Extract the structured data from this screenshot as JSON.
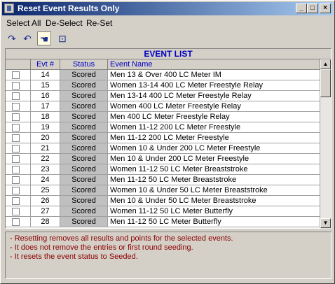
{
  "window": {
    "title": "Reset Event Results Only"
  },
  "title_buttons": {
    "minimize": "_",
    "maximize": "□",
    "close": "×"
  },
  "menu": [
    "Select All",
    "De-Select",
    "Re-Set"
  ],
  "toolbar": {
    "icons": [
      "redo-icon",
      "undo-icon",
      "select-all-icon",
      "open-folder-icon"
    ]
  },
  "grid": {
    "title": "EVENT LIST",
    "headers": {
      "check": "",
      "evt": "Evt #",
      "status": "Status",
      "name": "Event Name"
    },
    "rows": [
      {
        "evt": "14",
        "status": "Scored",
        "name": "Men 13 & Over 400 LC Meter IM"
      },
      {
        "evt": "15",
        "status": "Scored",
        "name": "Women 13-14 400 LC Meter Freestyle Relay"
      },
      {
        "evt": "16",
        "status": "Scored",
        "name": "Men 13-14 400 LC Meter Freestyle Relay"
      },
      {
        "evt": "17",
        "status": "Scored",
        "name": "Women 400 LC Meter Freestyle Relay"
      },
      {
        "evt": "18",
        "status": "Scored",
        "name": "Men 400 LC Meter Freestyle Relay"
      },
      {
        "evt": "19",
        "status": "Scored",
        "name": "Women 11-12 200 LC Meter Freestyle"
      },
      {
        "evt": "20",
        "status": "Scored",
        "name": "Men 11-12 200 LC Meter Freestyle"
      },
      {
        "evt": "21",
        "status": "Scored",
        "name": "Women 10 & Under 200 LC Meter Freestyle"
      },
      {
        "evt": "22",
        "status": "Scored",
        "name": "Men 10 & Under 200 LC Meter Freestyle"
      },
      {
        "evt": "23",
        "status": "Scored",
        "name": "Women 11-12 50 LC Meter Breaststroke"
      },
      {
        "evt": "24",
        "status": "Scored",
        "name": "Men 11-12 50 LC Meter Breaststroke"
      },
      {
        "evt": "25",
        "status": "Scored",
        "name": "Women 10 & Under 50 LC Meter Breaststroke"
      },
      {
        "evt": "26",
        "status": "Scored",
        "name": "Men 10 & Under 50 LC Meter Breaststroke"
      },
      {
        "evt": "27",
        "status": "Scored",
        "name": "Women 11-12 50 LC Meter Butterfly"
      },
      {
        "evt": "28",
        "status": "Scored",
        "name": "Men 11-12 50 LC Meter Butterfly"
      }
    ]
  },
  "notes": [
    "- Resetting removes all results and points for the selected events.",
    "- It does not remove the entries or first round seeding.",
    "- It resets the event status to Seeded."
  ],
  "colors": {
    "title_start": "#0a246a",
    "title_end": "#a6caf0",
    "header_text": "#0000c0",
    "note_text": "#8b0000",
    "status_bg": "#c0c0c0"
  }
}
